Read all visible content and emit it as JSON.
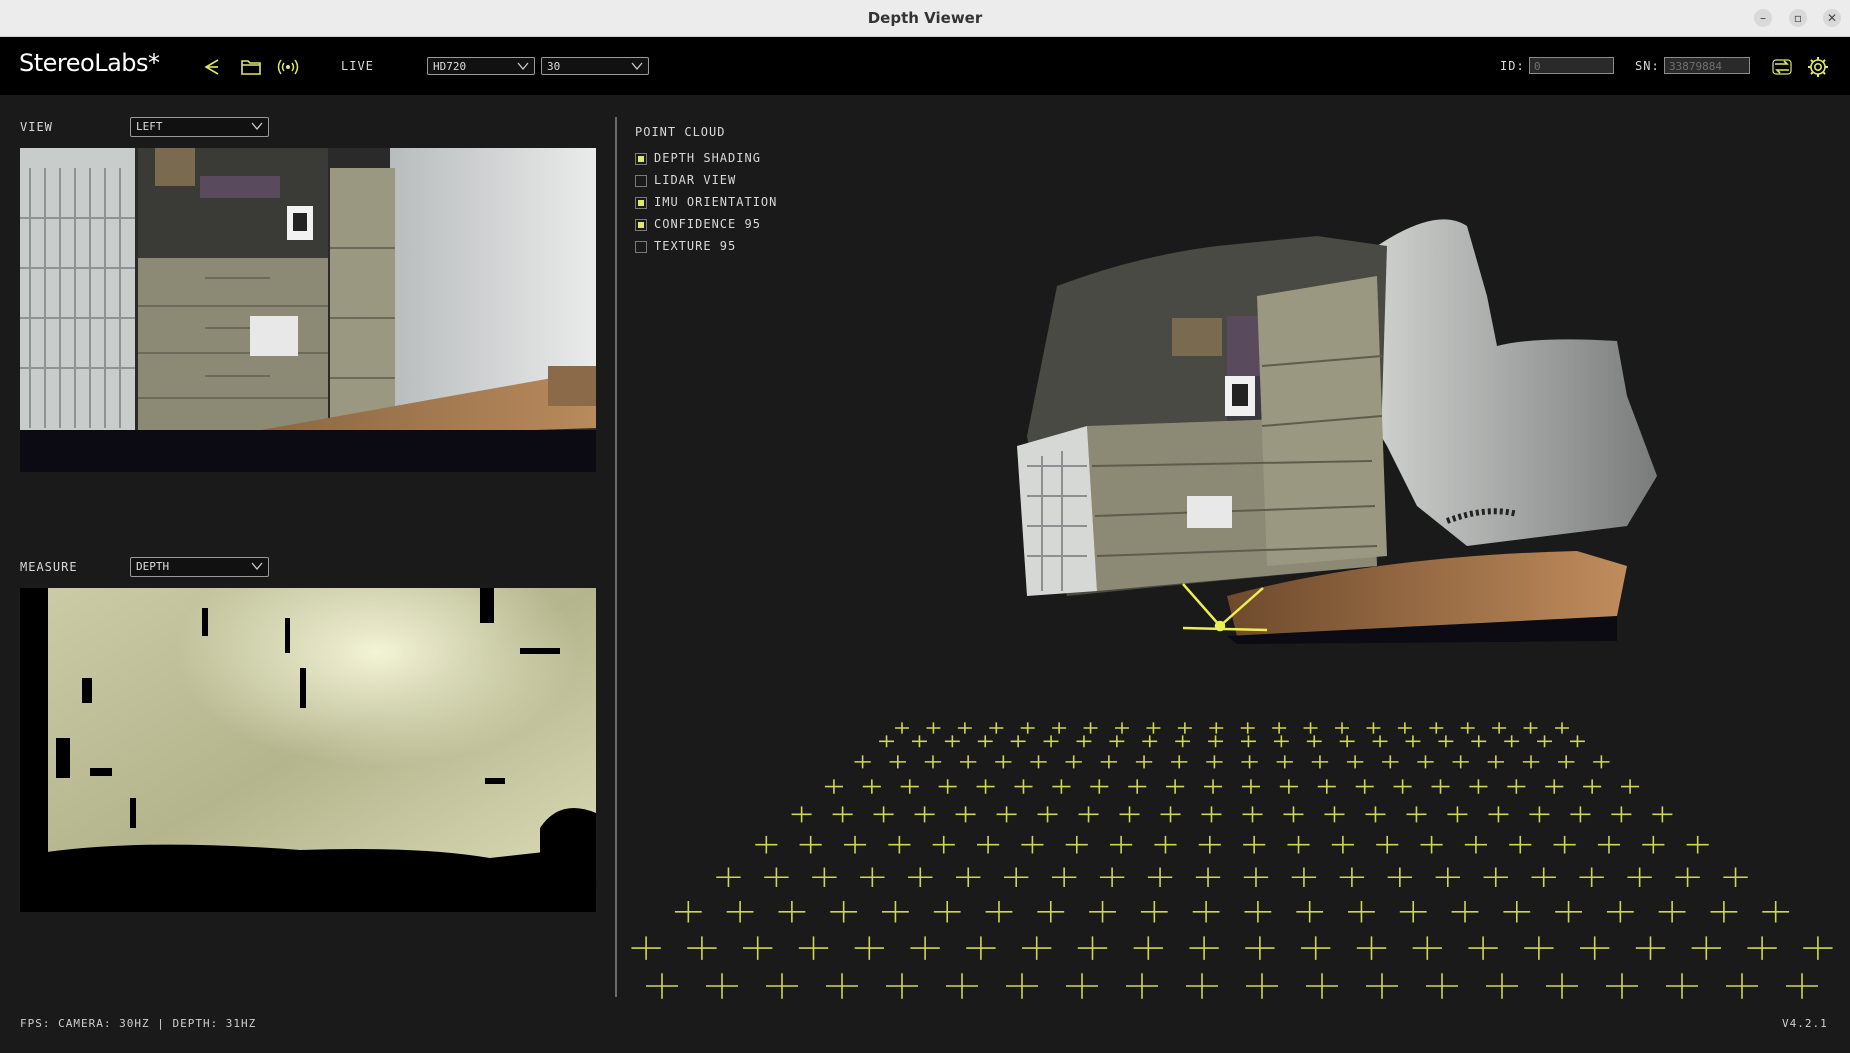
{
  "window": {
    "title": "Depth Viewer"
  },
  "toolbar": {
    "logo": "StereoLabs*",
    "mode": "LIVE",
    "resolution": "HD720",
    "fps": "30",
    "id_label": "ID:",
    "id_value": "0",
    "sn_label": "SN:",
    "sn_value": "33879884"
  },
  "icons": {
    "share": "share-icon",
    "folder": "folder-icon",
    "stream": "broadcast-icon",
    "refresh": "refresh-icon",
    "settings": "gear-icon"
  },
  "left": {
    "view_label": "VIEW",
    "view_value": "LEFT",
    "measure_label": "MEASURE",
    "measure_value": "DEPTH"
  },
  "point_cloud": {
    "title": "POINT CLOUD",
    "options": [
      {
        "label": "DEPTH SHADING",
        "checked": true
      },
      {
        "label": "LIDAR VIEW",
        "checked": false
      },
      {
        "label": "IMU ORIENTATION",
        "checked": true
      },
      {
        "label": "CONFIDENCE 95",
        "checked": true
      },
      {
        "label": "TEXTURE 95",
        "checked": false
      }
    ]
  },
  "footer": {
    "fps": "FPS: CAMERA: 30HZ | DEPTH: 31HZ",
    "version": "V4.2.1"
  },
  "colors": {
    "accent": "#dfe86a",
    "background": "#1a1a1a",
    "toolbar": "#000000"
  }
}
